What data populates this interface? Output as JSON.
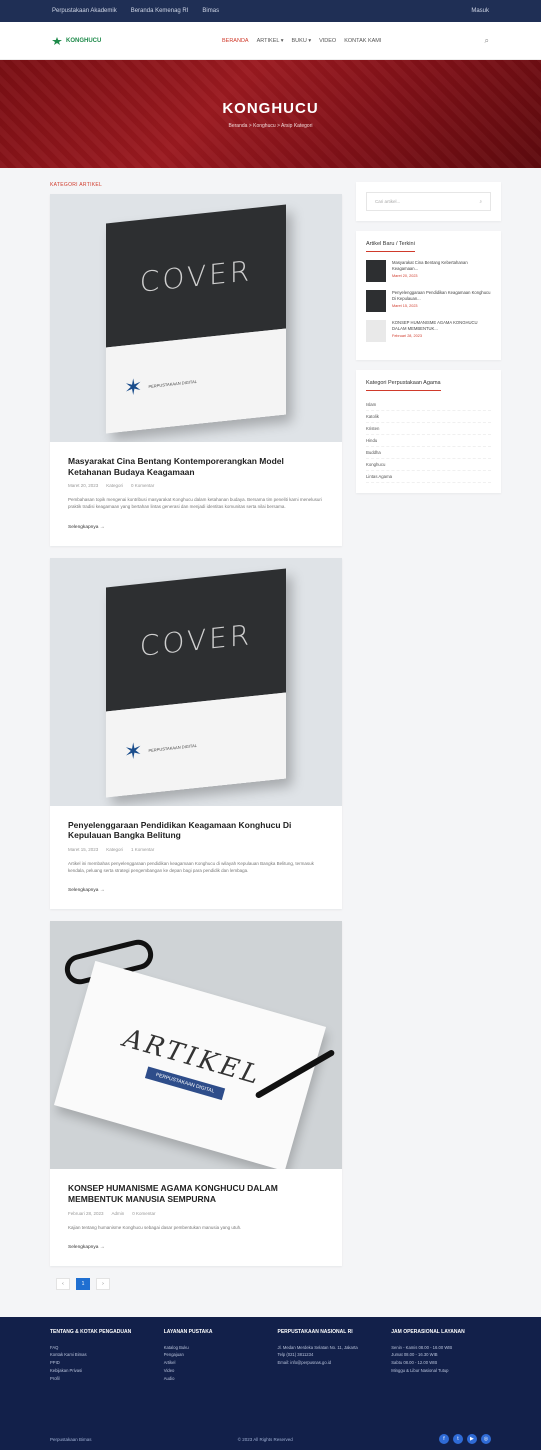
{
  "topbar": {
    "links": [
      "Perpustakaan Akademik",
      "Beranda Kemenag RI",
      "Bimas"
    ],
    "right_label": "Masuk"
  },
  "navbar": {
    "logo_text": "KONGHUCU",
    "items": [
      "BERANDA",
      "ARTIKEL ▾",
      "BUKU ▾",
      "VIDEO",
      "KONTAK KAMI"
    ],
    "active_index": 0
  },
  "hero": {
    "title": "KONGHUCU",
    "breadcrumb": "Beranda  >  Konghucu  >  Arsip Kategori"
  },
  "section_label": "KATEGORI ARTIKEL",
  "posts": [
    {
      "cover_text": "COVER",
      "org": "PERPUSTAKAAN DIGITAL",
      "title": "Masyarakat Cina Bentang Kontemporerangkan Model Ketahanan Budaya Keagamaan",
      "date": "Maret 20, 2023",
      "author": "Kategori",
      "comments": "0 Komentar",
      "excerpt": "Pembahasan topik mengenai kontribusi masyarakat Konghucu dalam ketahanan budaya. Bersama tim peneliti kami menelusuri praktik tradisi keagamaan yang bertahan lintas generasi dan menjadi identitas komunitas serta nilai bersama.",
      "more": "Selengkapnya →"
    },
    {
      "cover_text": "COVER",
      "org": "PERPUSTAKAAN DIGITAL",
      "title": "Penyelenggaraan Pendidikan Keagamaan Konghucu Di Kepulauan Bangka Belitung",
      "date": "Maret 15, 2023",
      "author": "Kategori",
      "comments": "1 Komentar",
      "excerpt": "Artikel ini membahas penyelenggaraan pendidikan keagamaan Konghucu di wilayah Kepulauan Bangka Belitung, termasuk kendala, peluang serta strategi pengembangan ke depan bagi para pendidik dan lembaga.",
      "more": "Selengkapnya →"
    },
    {
      "cover_text": "ARTIKEL",
      "band_text": "PERPUSTAKAAN DIGITAL",
      "title": "KONSEP HUMANISME AGAMA KONGHUCU DALAM MEMBENTUK MANUSIA SEMPURNA",
      "date": "Februari 28, 2023",
      "author": "Admin",
      "comments": "0 Komentar",
      "excerpt": "Kajian tentang humanisme Konghucu sebagai dasar pembentukan manusia yang utuh.",
      "more": "Selengkapnya →"
    }
  ],
  "pagination": [
    "‹",
    "1",
    "›"
  ],
  "sidebar": {
    "search_placeholder": "Cari artikel...",
    "recent_title": "Artikel Baru / Terkini",
    "recent": [
      {
        "title": "Masyarakat Cina Bentang Kebertahanan Keagamaan...",
        "date": "Maret 20, 2023"
      },
      {
        "title": "Penyelenggaraan Pendidikan Keagamaan Konghucu Di Kepulauan...",
        "date": "Maret 15, 2023"
      },
      {
        "title": "KONSEP HUMANISME AGAMA KONGHUCU DALAM MEMBENTUK...",
        "date": "Februari 28, 2023"
      }
    ],
    "categories_title": "Kategori Perpustakaan Agama",
    "categories": [
      "Islam",
      "Katolik",
      "Kristen",
      "Hindu",
      "Buddha",
      "Konghucu",
      "Lintas Agama"
    ]
  },
  "footer": {
    "col1_title": "TENTANG & KOTAK PENGADUAN",
    "col1_items": [
      "FAQ",
      "Kontak Kami Bimas",
      "PPID",
      "Kebijakan Privasi",
      "Profil"
    ],
    "col2_title": "LAYANAN PUSTAKA",
    "col2_items": [
      "Katalog Buku",
      "Pengajuan",
      "Artikel",
      "Video",
      "Audio"
    ],
    "col3_title": "PERPUSTAKAAN NASIONAL RI",
    "col3_items": [
      "Jl. Medan Merdeka Selatan No. 11, Jakarta",
      "Telp (021) 3811234",
      "Email: info@perpusnas.go.id"
    ],
    "col4_title": "JAM OPERASIONAL LAYANAN",
    "col4_items": [
      "Senin - Kamis 08.00 - 16.00 WIB",
      "Jumat 08.00 - 16.30 WIB",
      "Sabtu 08.00 - 12.00 WIB",
      "Minggu & Libur Nasional Tutup"
    ],
    "copyright": "© 2023 All Rights Reserved",
    "left_note": "Perpustakaan Bimas"
  }
}
